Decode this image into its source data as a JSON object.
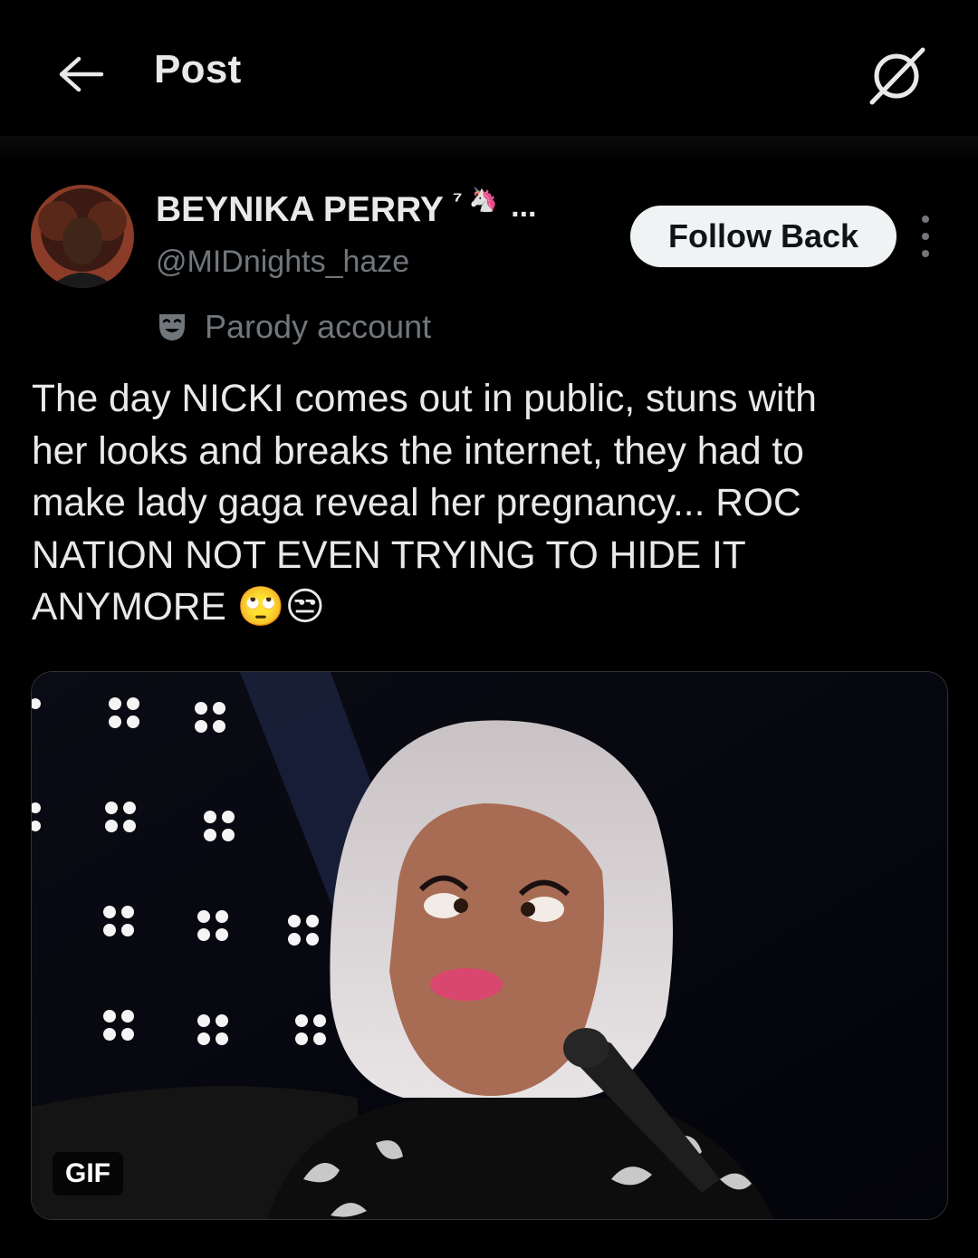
{
  "header": {
    "title": "Post"
  },
  "icons": {
    "back": "arrow-left-icon",
    "grok": "grok-icon",
    "more": "more-vertical-icon",
    "parody": "parody-mask-icon"
  },
  "author": {
    "display_name": "BEYNIKA PERRY",
    "name_suffix": "⁷ 🦄",
    "name_ellipsis": "...",
    "handle": "@MIDnights_haze",
    "label": "Parody account"
  },
  "actions": {
    "follow_label": "Follow Back"
  },
  "post": {
    "text": "The day NICKI comes out in public, stuns with\nher looks and breaks the internet, they had to\nmake lady gaga reveal her pregnancy... ROC\nNATION NOT EVEN TRYING TO HIDE IT\nANYMORE 🙄😒",
    "media_badge": "GIF"
  },
  "colors": {
    "background": "#000000",
    "text_primary": "#e7e9ea",
    "text_secondary": "#71767b",
    "button_bg": "#eff3f4",
    "button_text": "#0f1419",
    "border": "#2f3336"
  }
}
